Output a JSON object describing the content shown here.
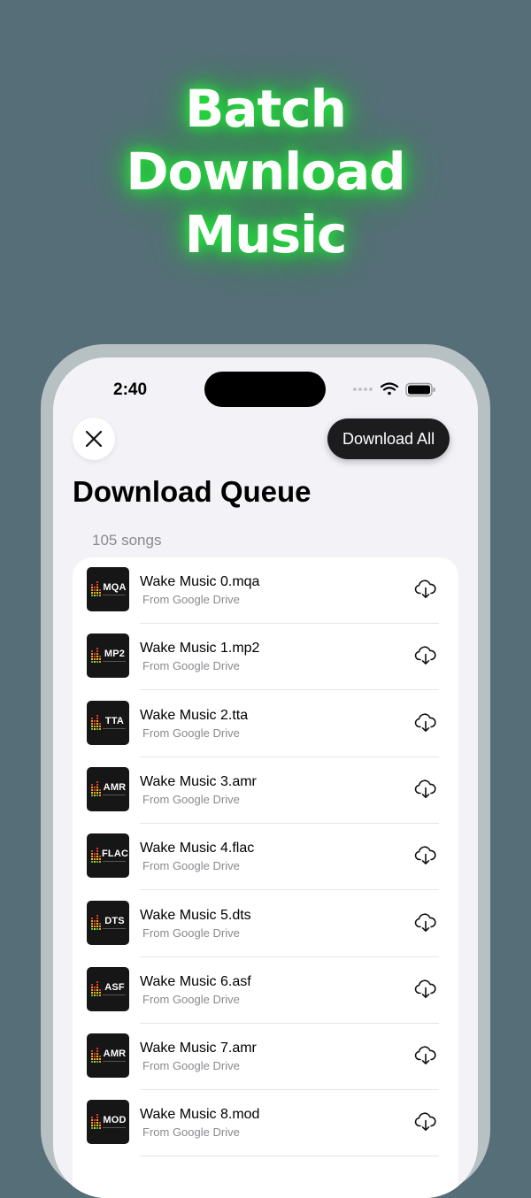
{
  "promo": {
    "headline": [
      "Batch",
      "Download",
      "Music"
    ],
    "glow_color": "#22e63a"
  },
  "status_bar": {
    "time": "2:40"
  },
  "header": {
    "close_icon": "close-icon",
    "download_all_label": "Download All",
    "title": "Download Queue",
    "count_label": "105 songs"
  },
  "songs": [
    {
      "title": "Wake Music 0.mqa",
      "source": "From Google Drive",
      "format": "MQA",
      "icon": "cloud-download-icon"
    },
    {
      "title": "Wake Music 1.mp2",
      "source": "From Google Drive",
      "format": "MP2",
      "icon": "cloud-download-icon"
    },
    {
      "title": "Wake Music 2.tta",
      "source": "From Google Drive",
      "format": "TTA",
      "icon": "cloud-download-icon"
    },
    {
      "title": "Wake Music 3.amr",
      "source": "From Google Drive",
      "format": "AMR",
      "icon": "cloud-download-icon"
    },
    {
      "title": "Wake Music 4.flac",
      "source": "From Google Drive",
      "format": "FLAC",
      "icon": "cloud-download-icon"
    },
    {
      "title": "Wake Music 5.dts",
      "source": "From Google Drive",
      "format": "DTS",
      "icon": "cloud-download-icon"
    },
    {
      "title": "Wake Music 6.asf",
      "source": "From Google Drive",
      "format": "ASF",
      "icon": "cloud-download-icon"
    },
    {
      "title": "Wake Music 7.amr",
      "source": "From Google Drive",
      "format": "AMR",
      "icon": "cloud-download-icon"
    },
    {
      "title": "Wake Music 8.mod",
      "source": "From Google Drive",
      "format": "MOD",
      "icon": "cloud-download-icon"
    }
  ]
}
